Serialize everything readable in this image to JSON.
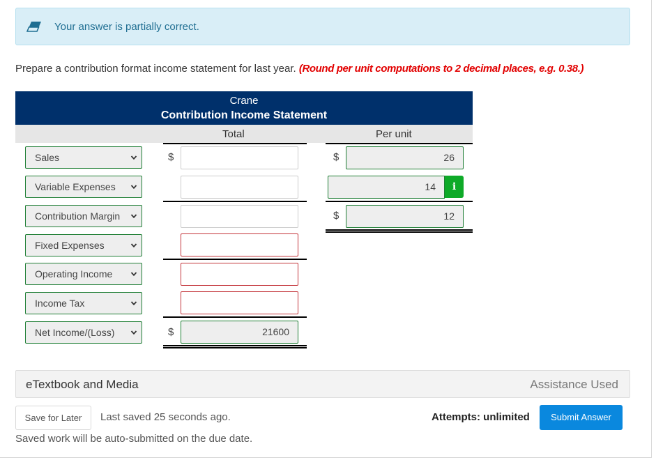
{
  "feedback": {
    "icon": "eraser-icon",
    "message": "Your answer is partially correct."
  },
  "instructions": {
    "text": "Prepare a contribution format income statement for last year.",
    "hint": "(Round per unit computations to 2 decimal places, e.g. 0.38.)"
  },
  "statement": {
    "company": "Crane",
    "title": "Contribution Income Statement",
    "columns": {
      "total": "Total",
      "per_unit": "Per unit"
    },
    "currency_symbol": "$",
    "rows": [
      {
        "label": "Sales",
        "total": "",
        "total_status": "neutral",
        "per_unit": "26",
        "per_unit_status": "correct"
      },
      {
        "label": "Variable Expenses",
        "total": "",
        "total_status": "neutral",
        "per_unit": "14",
        "per_unit_status": "correct"
      },
      {
        "label": "Contribution Margin",
        "total": "",
        "total_status": "neutral",
        "per_unit": "12",
        "per_unit_status": "correct"
      },
      {
        "label": "Fixed Expenses",
        "total": "",
        "total_status": "error"
      },
      {
        "label": "Operating Income",
        "total": "",
        "total_status": "error"
      },
      {
        "label": "Income Tax",
        "total": "",
        "total_status": "error"
      },
      {
        "label": "Net Income/(Loss)",
        "total": "21600",
        "total_status": "correct"
      }
    ],
    "info_button": "i"
  },
  "media": {
    "label": "eTextbook and Media",
    "status": "Assistance Used"
  },
  "footer": {
    "save_label": "Save for Later",
    "last_saved": "Last saved 25 seconds ago.",
    "auto_submit_note": "Saved work will be auto-submitted on the due date.",
    "attempts": "Attempts: unlimited",
    "submit_label": "Submit Answer"
  },
  "colors": {
    "header_bg": "#00306b",
    "correct_border": "#1e7e34",
    "error_border": "#c3343a",
    "info_green": "#0eaa28",
    "submit_blue": "#0a88de",
    "hint_red": "#e20000",
    "alert_bg": "#d9eef7"
  }
}
